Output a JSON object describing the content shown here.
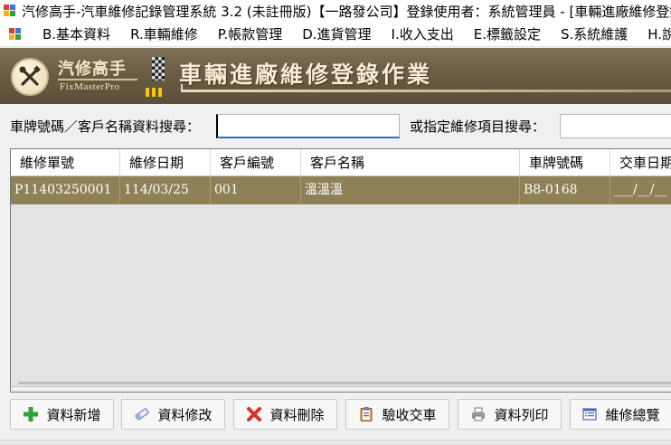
{
  "window": {
    "title": "汽修高手-汽車維修記錄管理系統 3.2 (未註冊版)【一路發公司】登錄使用者：系統管理員 - [車輛進廠維修登錄作業]"
  },
  "menu": {
    "items": [
      {
        "label": "B.基本資料"
      },
      {
        "label": "R.車輛維修"
      },
      {
        "label": "P.帳款管理"
      },
      {
        "label": "D.進貨管理"
      },
      {
        "label": "I.收入支出"
      },
      {
        "label": "E.標籤設定"
      },
      {
        "label": "S.系統維護"
      },
      {
        "label": "H.說明"
      }
    ]
  },
  "banner": {
    "logo_cn": "汽修高手",
    "logo_en": "FixMasterPro",
    "title": "車輛進廠維修登錄作業",
    "icon": "tools-icon"
  },
  "search": {
    "label": "車牌號碼／客戶名稱資料搜尋：",
    "value": "",
    "label2": "或指定維修項目搜尋：",
    "value2": ""
  },
  "grid": {
    "columns": [
      "維修單號",
      "維修日期",
      "客戶編號",
      "客戶名稱",
      "車牌號碼",
      "交車日期"
    ],
    "rows": [
      [
        "P11403250001",
        "114/03/25",
        "001",
        "溫溫溫",
        "B8-0168",
        "___/__/__"
      ]
    ],
    "selected_row_color": "#8f8157"
  },
  "buttons": [
    {
      "label": "資料新增",
      "icon": "plus-icon"
    },
    {
      "label": "資料修改",
      "icon": "eraser-icon"
    },
    {
      "label": "資料刪除",
      "icon": "x-icon"
    },
    {
      "label": "驗收交車",
      "icon": "clipboard-icon"
    },
    {
      "label": "資料列印",
      "icon": "printer-icon"
    },
    {
      "label": "維修總覽",
      "icon": "list-icon"
    }
  ]
}
